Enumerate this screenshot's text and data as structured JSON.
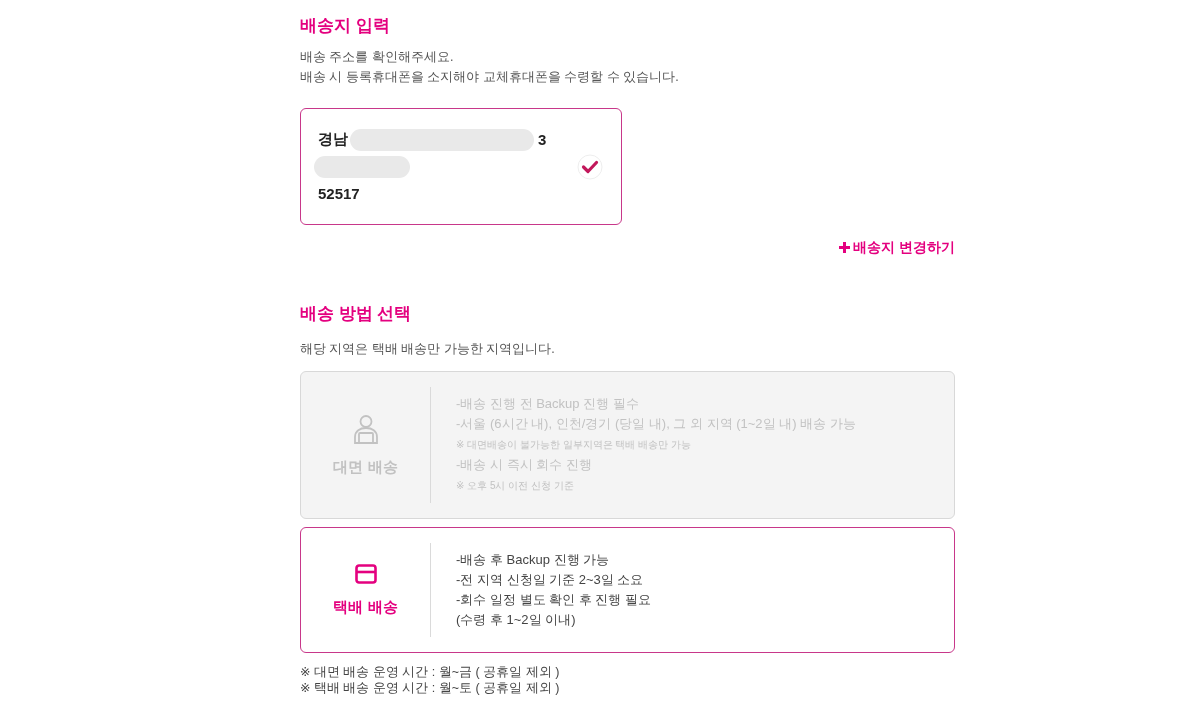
{
  "address_section": {
    "title": "배송지 입력",
    "description": [
      "배송 주소를 확인해주세요.",
      "배송 시 등록휴대폰을 소지해야 교체휴대폰을 수령할 수 있습니다."
    ],
    "address_card": {
      "selected": true,
      "lines": [
        [
          {
            "kind": "text",
            "text": "경남"
          },
          {
            "kind": "blur_long"
          },
          {
            "kind": "text",
            "text": "3"
          }
        ],
        [
          {
            "kind": "blur_short"
          }
        ],
        [
          {
            "kind": "text",
            "text": "52517"
          }
        ]
      ]
    },
    "change_link": {
      "label": "배송지 변경하기"
    }
  },
  "method_section": {
    "title": "배송 방법 선택",
    "description": "해당 지역은 택배 배송만 가능한 지역입니다.",
    "options": [
      {
        "kind": "in_person",
        "label": "대면 배송",
        "disabled": true,
        "selected": false,
        "details": [
          {
            "kind": "main",
            "text": "-배송 진행 전 Backup 진행 필수"
          },
          {
            "kind": "main",
            "text": "-서울 (6시간 내), 인천/경기 (당일 내), 그 외 지역 (1~2일 내) 배송 가능"
          },
          {
            "kind": "note",
            "text": "※ 대면배송이 불가능한 일부지역은 택배 배송만 가능"
          },
          {
            "kind": "main",
            "text": "-배송 시 즉시 회수 진행"
          },
          {
            "kind": "note",
            "text": "※ 오후 5시 이전 신청 기준"
          }
        ]
      },
      {
        "kind": "courier",
        "label": "택배 배송",
        "disabled": false,
        "selected": true,
        "details": [
          {
            "kind": "main",
            "text": "-배송 후 Backup 진행 가능"
          },
          {
            "kind": "main",
            "text": "-전 지역 신청일 기준 2~3일 소요"
          },
          {
            "kind": "main",
            "text": "-회수 일정 별도 확인 후 진행 필요"
          },
          {
            "kind": "main",
            "text": "(수령 후 1~2일 이내)"
          }
        ]
      }
    ]
  },
  "footnotes": [
    "※ 대면 배송 운영 시간 : 월~금 ( 공휴일 제외 )",
    "※ 택배 배송 운영 시간 : 월~토 ( 공휴일 제외 )"
  ]
}
